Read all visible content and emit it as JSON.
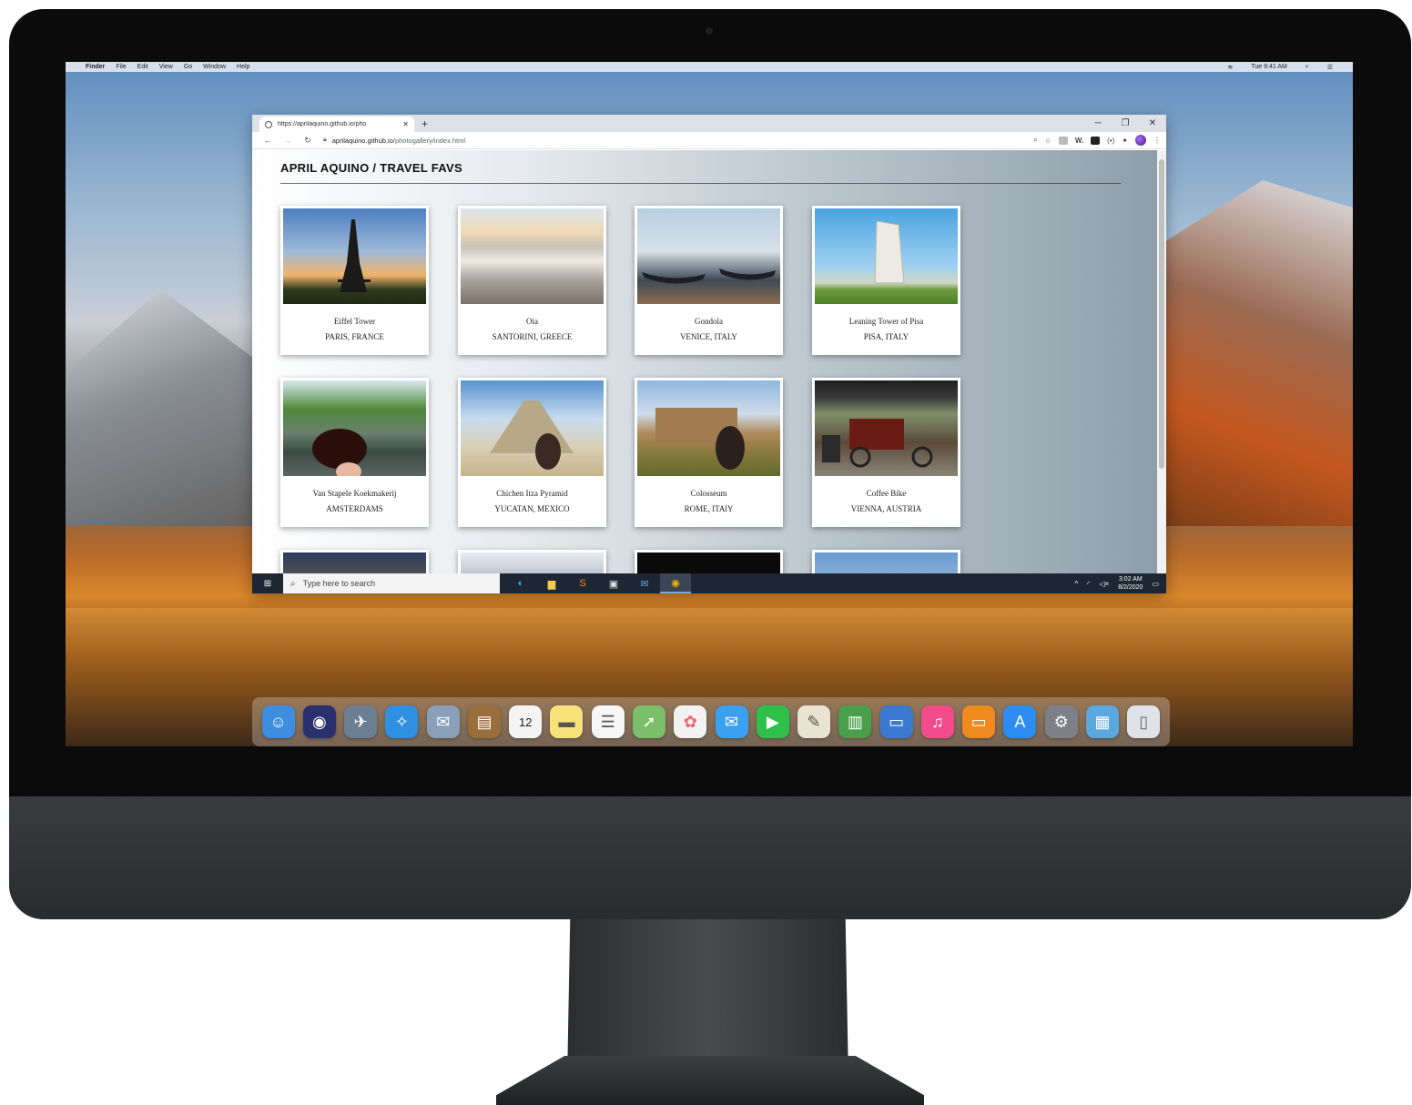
{
  "mac": {
    "menubar": [
      "Finder",
      "File",
      "Edit",
      "View",
      "Go",
      "Window",
      "Help"
    ],
    "status": "Tue 9:41 AM"
  },
  "browser": {
    "tab_title": "https://aprilaquino.github.io/pho",
    "url_domain": "aprilaquino.github.io",
    "url_path": "/photogallery/index.html"
  },
  "page": {
    "title": "APRIL AQUINO / TRAVEL FAVS",
    "cards": [
      {
        "name": "Eiffel Tower",
        "place": "PARIS, FRANCE"
      },
      {
        "name": "Oia",
        "place": "SANTORINI, GREECE"
      },
      {
        "name": "Gondola",
        "place": "VENICE, ITALY"
      },
      {
        "name": "Leaning Tower of Pisa",
        "place": "PISA, ITALY"
      },
      {
        "name": "Van Stapele Koekmakerij",
        "place": "AMSTERDAMS"
      },
      {
        "name": "Chichen Itza Pyramid",
        "place": "YUCATAN, MEXICO"
      },
      {
        "name": "Colosseum",
        "place": "ROME, ITAlY"
      },
      {
        "name": "Coffee Bike",
        "place": "VIENNA, AUSTRIA"
      }
    ]
  },
  "taskbar": {
    "search_placeholder": "Type here to search",
    "time": "3:02 AM",
    "date": "8/2/2020"
  },
  "icons": {
    "dock_calendar_day": "12"
  }
}
